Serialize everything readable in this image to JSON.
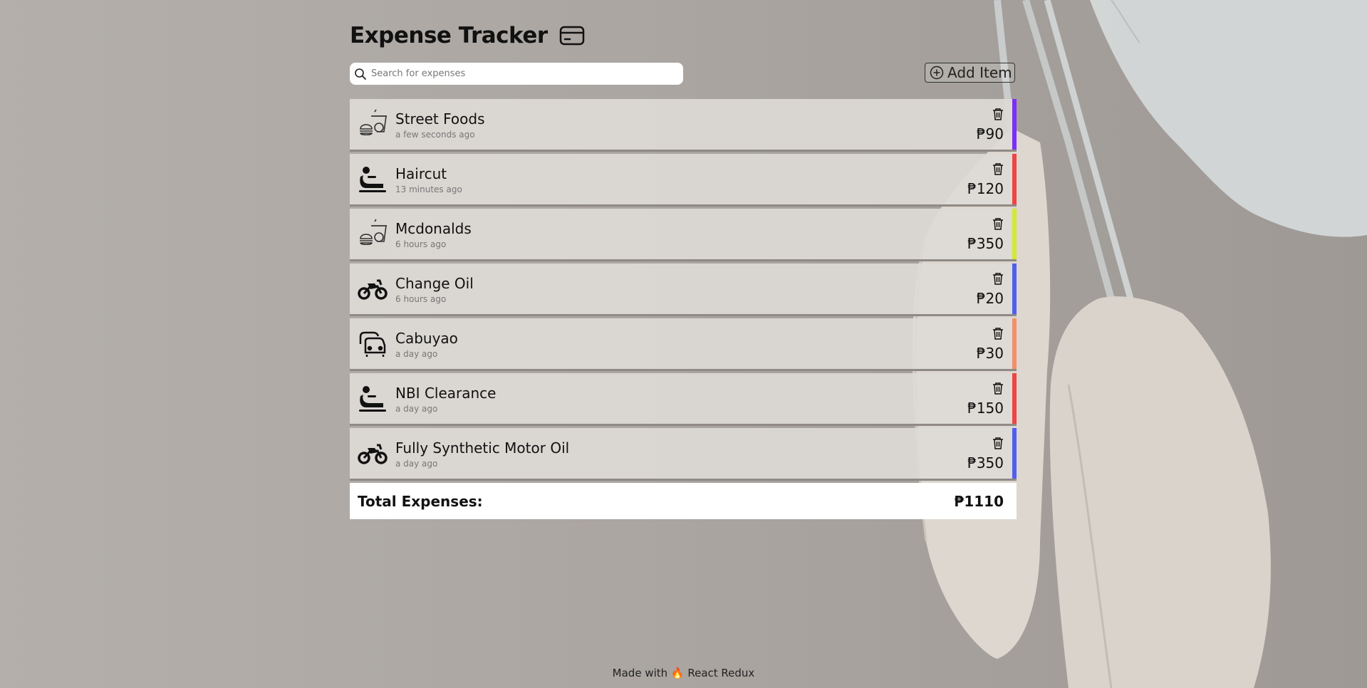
{
  "app": {
    "title": "Expense Tracker",
    "title_icon": "credit-card-icon"
  },
  "search": {
    "placeholder": "Search for expenses",
    "value": "",
    "icon": "search-icon"
  },
  "add_button": {
    "label": "Add Item",
    "icon": "plus-circle-icon"
  },
  "expenses": [
    {
      "name": "Street Foods",
      "time": "a few seconds ago",
      "amount": "₱90",
      "category_icon": "food-icon",
      "color": "#7b2ff7"
    },
    {
      "name": "Haircut",
      "time": "13 minutes ago",
      "amount": "₱120",
      "category_icon": "massage-icon",
      "color": "#ef4444"
    },
    {
      "name": "Mcdonalds",
      "time": "6 hours ago",
      "amount": "₱350",
      "category_icon": "food-icon",
      "color": "#d4e832"
    },
    {
      "name": "Change Oil",
      "time": "6 hours ago",
      "amount": "₱20",
      "category_icon": "motorbike-icon",
      "color": "#4f5ef0"
    },
    {
      "name": "Cabuyao",
      "time": "a day ago",
      "amount": "₱30",
      "category_icon": "cars-icon",
      "color": "#f2906a"
    },
    {
      "name": "NBI Clearance",
      "time": "a day ago",
      "amount": "₱150",
      "category_icon": "massage-icon",
      "color": "#ef4444"
    },
    {
      "name": "Fully Synthetic Motor Oil",
      "time": "a day ago",
      "amount": "₱350",
      "category_icon": "motorbike-icon",
      "color": "#4f5ef0"
    }
  ],
  "total": {
    "label": "Total Expenses:",
    "value": "₱1110"
  },
  "footer": {
    "text": "Made with 🔥 React Redux"
  }
}
